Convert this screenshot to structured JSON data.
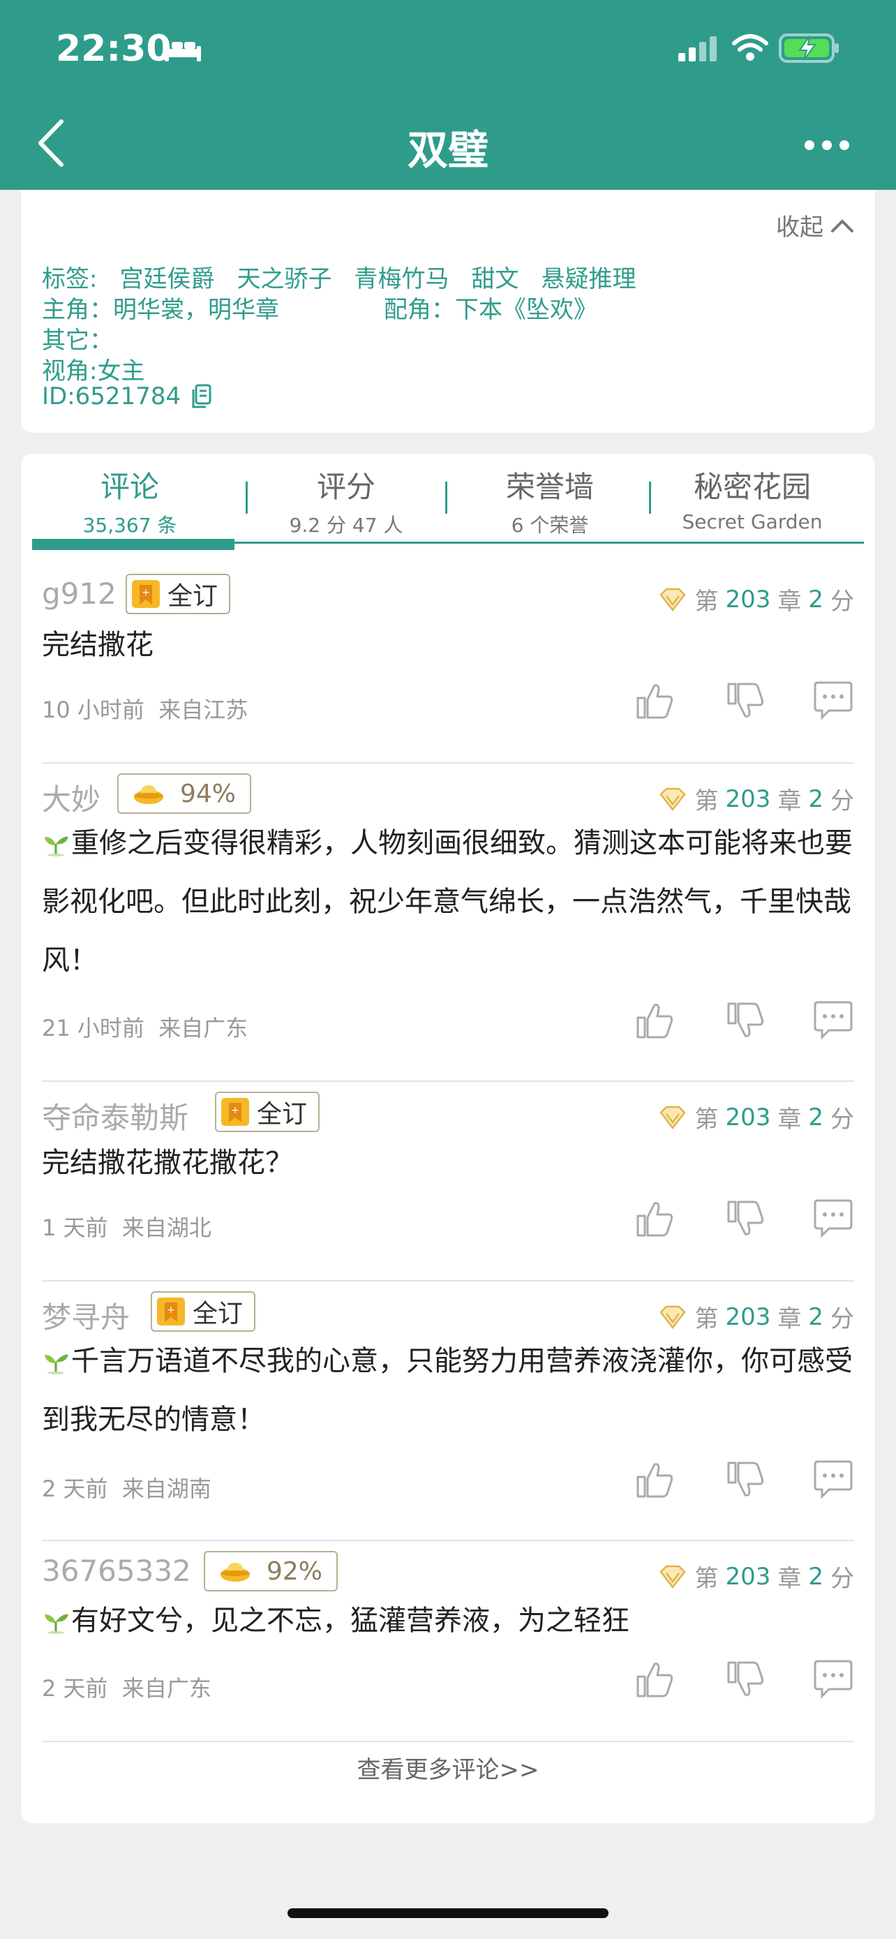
{
  "status_bar": {
    "time": "22:30"
  },
  "header": {
    "title": "双璧"
  },
  "info": {
    "collapse_label": "收起",
    "tags_label": "标签:",
    "tags": [
      "宫廷侯爵",
      "天之骄子",
      "青梅竹马",
      "甜文",
      "悬疑推理"
    ],
    "lead_roles": "主角：明华裳，明华章",
    "supporting_roles": "配角：下本《坠欢》",
    "other": "其它：",
    "perspective": "视角:女主",
    "id": "ID:6521784"
  },
  "tabs": [
    {
      "label": "评论",
      "sub": "35,367 条"
    },
    {
      "label": "评分",
      "sub": "9.2 分 47 人"
    },
    {
      "label": "荣誉墙",
      "sub": "6 个荣誉"
    },
    {
      "label": "秘密花园",
      "sub": "Secret Garden"
    }
  ],
  "comments": [
    {
      "user": "g912",
      "badge": "全订",
      "chapter_prefix": "第",
      "chapter": "203",
      "chapter_unit": "章",
      "score": "2",
      "score_unit": "分",
      "text": "完结撒花",
      "time": "10 小时前",
      "location": "来自江苏"
    },
    {
      "user": "大妙",
      "badge": "94%",
      "chapter_prefix": "第",
      "chapter": "203",
      "chapter_unit": "章",
      "score": "2",
      "score_unit": "分",
      "text": "重修之后变得很精彩，人物刻画很细致。猜测这本可能将来也要影视化吧。但此时此刻，祝少年意气绵长，一点浩然气，千里快哉风！",
      "time": "21 小时前",
      "location": "来自广东"
    },
    {
      "user": "夺命泰勒斯",
      "badge": "全订",
      "chapter_prefix": "第",
      "chapter": "203",
      "chapter_unit": "章",
      "score": "2",
      "score_unit": "分",
      "text": "完结撒花撒花撒花？",
      "time": "1 天前",
      "location": "来自湖北"
    },
    {
      "user": "梦寻舟",
      "badge": "全订",
      "chapter_prefix": "第",
      "chapter": "203",
      "chapter_unit": "章",
      "score": "2",
      "score_unit": "分",
      "text": "千言万语道不尽我的心意，只能努力用营养液浇灌你，你可感受到我无尽的情意！",
      "time": "2 天前",
      "location": "来自湖南"
    },
    {
      "user": "36765332",
      "badge": "92%",
      "chapter_prefix": "第",
      "chapter": "203",
      "chapter_unit": "章",
      "score": "2",
      "score_unit": "分",
      "text": "有好文兮，见之不忘，猛灌营养液，为之轻狂",
      "time": "2 天前",
      "location": "来自广东"
    }
  ],
  "see_more": "查看更多评论>>",
  "colors": {
    "accent": "#2f9c8b"
  }
}
